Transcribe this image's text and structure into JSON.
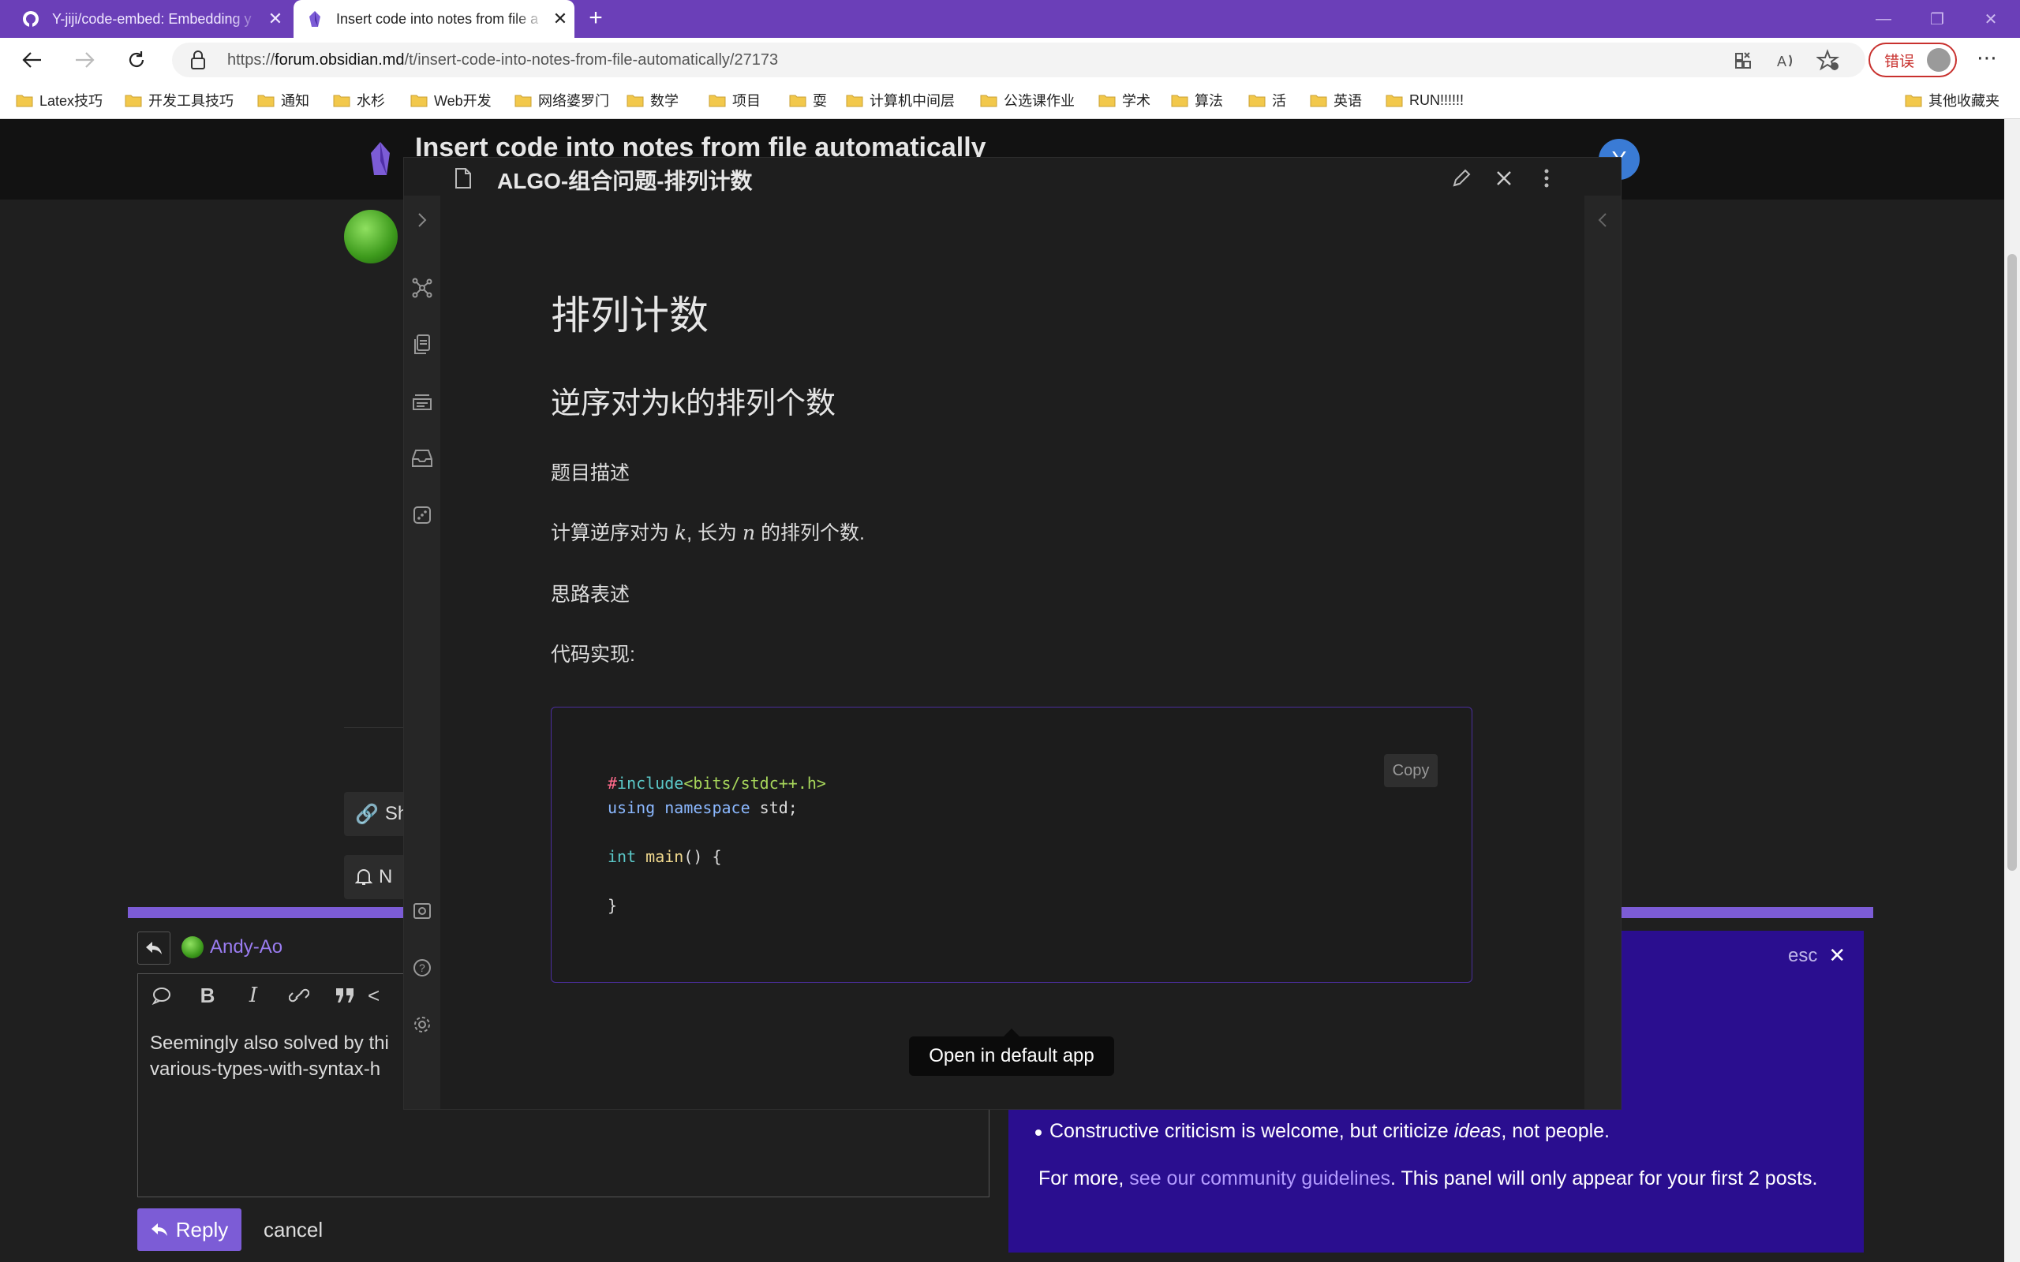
{
  "browser": {
    "tabs": [
      {
        "title": "Y-jiji/code-embed: Embedding y",
        "icon": "github-icon",
        "active": false
      },
      {
        "title": "Insert code into notes from file a",
        "icon": "obsidian-icon",
        "active": true
      }
    ],
    "url_prefix": "https://",
    "url_host": "forum.obsidian.md",
    "url_path": "/t/insert-code-into-notes-from-file-automatically/27173",
    "profile_button": "错误",
    "bookmarks": [
      "Latex技巧",
      "开发工具技巧",
      "通知",
      "水杉",
      "Web开发",
      "网络婆罗门",
      "数学",
      "项目",
      "耍",
      "计算机中间层",
      "公选课作业",
      "学术",
      "算法",
      "活",
      "英语",
      "RUN!!!!!!"
    ],
    "other_bookmarks": "其他收藏夹"
  },
  "forum": {
    "topic_title": "Insert code into notes from file automatically",
    "user_initial": "Y",
    "share_fragment": "Sh",
    "notify_fragment": "N"
  },
  "composer": {
    "username": "Andy-Ao",
    "text_line1": "Seemingly also solved by thi",
    "text_line2": "various-types-with-syntax-h",
    "reply_label": "Reply",
    "cancel_label": "cancel"
  },
  "guidelines": {
    "esc_label": "esc",
    "bullet_pre": "Constructive criticism is welcome, but criticize ",
    "bullet_em": "ideas",
    "bullet_post": ", not people.",
    "more_pre": "For more, ",
    "more_link": "see our community guidelines",
    "more_post": ". This panel will only appear for your first 2 posts."
  },
  "obsidian": {
    "note_title": "ALGO-组合问题-排列计数",
    "h1": "排列计数",
    "h2": "逆序对为k的排列个数",
    "p_problem": "题目描述",
    "p_desc_a": "计算逆序对为 ",
    "p_desc_k": "k",
    "p_desc_b": ", 长为 ",
    "p_desc_n": "n",
    "p_desc_c": " 的排列个数.",
    "p_idea": "思路表述",
    "p_code": "代码实现:",
    "copy_label": "Copy",
    "tooltip": "Open in default app",
    "code": {
      "l1_hash": "#",
      "l1_include": "include",
      "l1_header": "<bits/stdc++.h>",
      "l2_using": "using",
      "l2_namespace": "namespace",
      "l2_rest": " std;",
      "l4_int": "int",
      "l4_main": "main",
      "l4_rest": "() {",
      "l6": "}"
    }
  }
}
